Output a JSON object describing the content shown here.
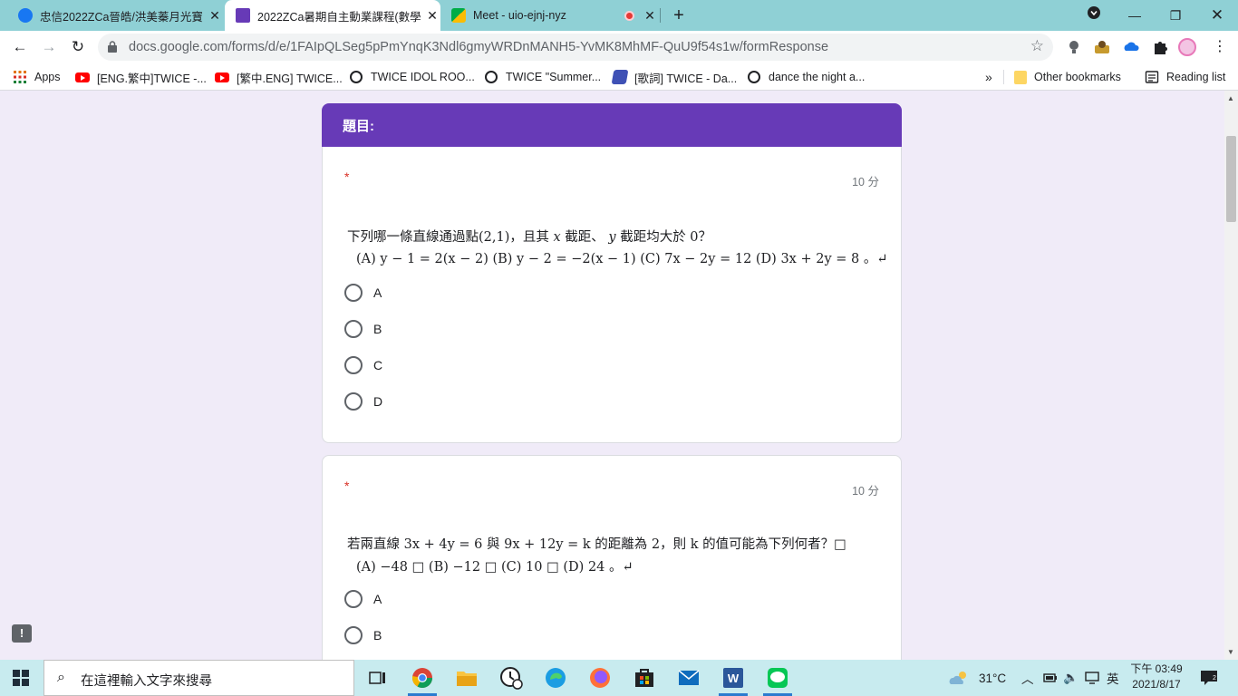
{
  "browser": {
    "tabs": [
      {
        "title": "忠信2022ZCa晉皓/洪美蓁月光寶",
        "active": false
      },
      {
        "title": "2022ZCa暑期自主動業課程(數學",
        "active": true
      },
      {
        "title": "Meet - uio-ejnj-nyz",
        "active": false
      }
    ],
    "url": "docs.google.com/forms/d/e/1FAIpQLSeg5pPmYnqK3Ndl6gmyWRDnMANH5-YvMK8MhMF-QuU9f54s1w/formResponse",
    "bookmarks": [
      {
        "label": "Apps"
      },
      {
        "label": "[ENG.繁中]TWICE -..."
      },
      {
        "label": "[繁中.ENG] TWICE..."
      },
      {
        "label": "TWICE IDOL ROO..."
      },
      {
        "label": "TWICE \"Summer..."
      },
      {
        "label": "[歌詞] TWICE - Da..."
      },
      {
        "label": "dance the night a..."
      }
    ],
    "overflow": "»",
    "other_bookmarks": "Other bookmarks",
    "reading_list": "Reading list"
  },
  "form": {
    "section_title": "題目:",
    "questions": [
      {
        "required_mark": "*",
        "points": "10 分",
        "line1_pre": "下列哪一條直線通過點(2,1)，且其",
        "line1_x": "x",
        "line1_mid": "截距、",
        "line1_y": "y",
        "line1_post": "截距均大於 0？",
        "line2": "(A) y − 1 = 2(x − 2) (B) y − 2 = −2(x − 1) (C) 7x − 2y = 12 (D) 3x + 2y = 8 。↵",
        "options": [
          "A",
          "B",
          "C",
          "D"
        ]
      },
      {
        "required_mark": "*",
        "points": "10 分",
        "line1": "若兩直線 3x + 4y = 6 與 9x + 12y = k 的距離為 2，則 k 的值可能為下列何者？□",
        "line2": "(A) −48 □ (B) −12 □ (C) 10 □ (D) 24 。↵",
        "options": [
          "A",
          "B"
        ]
      }
    ]
  },
  "taskbar": {
    "search_placeholder": "在這裡輸入文字來搜尋",
    "weather": "31°C",
    "ime": "英",
    "time": "下午 03:49",
    "date": "2021/8/17"
  },
  "colors": {
    "form_header": "#673ab7",
    "page_bg": "#f0ebf8",
    "tabstrip": "#8fd0d5",
    "taskbar": "#c8ebef"
  }
}
